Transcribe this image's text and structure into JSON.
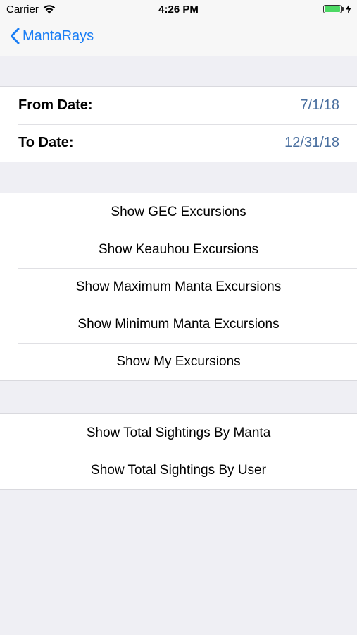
{
  "status_bar": {
    "carrier": "Carrier",
    "time": "4:26 PM",
    "battery_level": 1.0
  },
  "nav": {
    "back_label": "MantaRays"
  },
  "dates": {
    "from_label": "From Date:",
    "from_value": "7/1/18",
    "to_label": "To Date:",
    "to_value": "12/31/18"
  },
  "excursions": [
    {
      "label": "Show GEC Excursions"
    },
    {
      "label": "Show Keauhou Excursions"
    },
    {
      "label": "Show Maximum Manta Excursions"
    },
    {
      "label": "Show Minimum Manta Excursions"
    },
    {
      "label": "Show My Excursions"
    }
  ],
  "sightings": [
    {
      "label": "Show Total Sightings By Manta"
    },
    {
      "label": "Show Total Sightings By User"
    }
  ],
  "colors": {
    "tint": "#1a7ef5",
    "detail_value": "#4a6f9f",
    "background": "#efeff4",
    "battery": "#4cd964"
  }
}
